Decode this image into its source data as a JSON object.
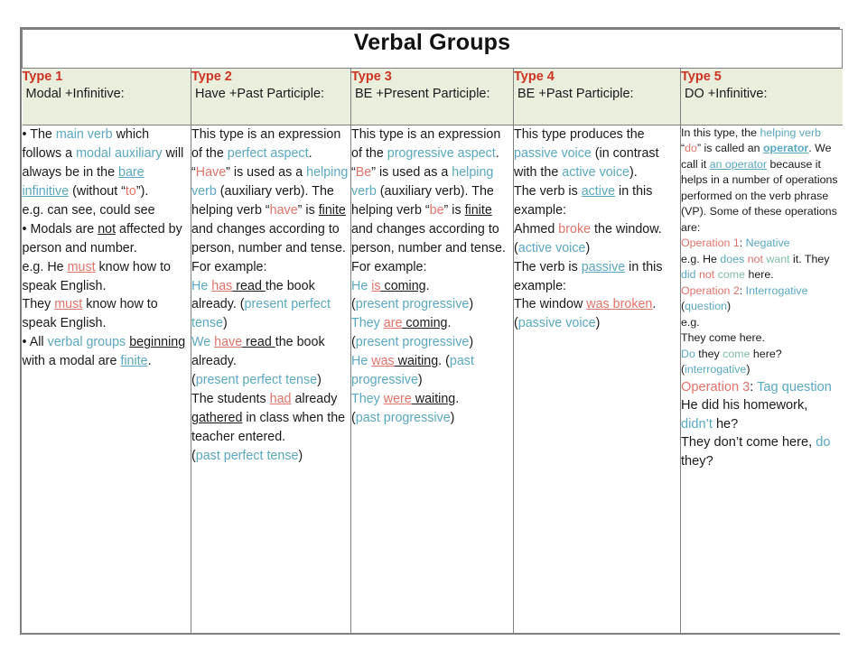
{
  "title": "Verbal Groups",
  "colors": {
    "header_bg": "#eaeedd",
    "type_heading": "#cc3322",
    "teal_term": "#5aa8c0",
    "red_emphasis": "#e0736a",
    "green_term": "#7fbfa8",
    "border": "#808080"
  },
  "columns": [
    {
      "type_label": "Type 1",
      "type_desc": "Modal +Infinitive:",
      "body": [
        {
          "runs": [
            {
              "t": "• The ",
              "s": "plain"
            },
            {
              "t": "main verb",
              "s": "teal"
            },
            {
              "t": " which follows a ",
              "s": "plain"
            },
            {
              "t": "modal auxiliary",
              "s": "teal"
            },
            {
              "t": " will always be in the ",
              "s": "plain"
            },
            {
              "t": "bare infinitive",
              "s": "teal-underline"
            },
            {
              "t": " (without “",
              "s": "plain"
            },
            {
              "t": "to",
              "s": "red"
            },
            {
              "t": "”).",
              "s": "plain"
            }
          ]
        },
        {
          "runs": [
            {
              "t": "e.g. can see, could see",
              "s": "plain"
            }
          ]
        },
        {
          "runs": [
            {
              "t": "• Modals are ",
              "s": "plain"
            },
            {
              "t": "not",
              "s": "underline"
            },
            {
              "t": " affected by person and number.",
              "s": "plain"
            }
          ]
        },
        {
          "runs": [
            {
              "t": "e.g. He ",
              "s": "plain"
            },
            {
              "t": "must",
              "s": "red-underline"
            },
            {
              "t": " know how to speak English.",
              "s": "plain"
            }
          ]
        },
        {
          "runs": [
            {
              "t": "They ",
              "s": "plain"
            },
            {
              "t": "must",
              "s": "red-underline"
            },
            {
              "t": " know how to speak English.",
              "s": "plain"
            }
          ]
        },
        {
          "runs": [
            {
              "t": "• All ",
              "s": "plain"
            },
            {
              "t": "verbal groups",
              "s": "teal"
            },
            {
              "t": " ",
              "s": "plain"
            },
            {
              "t": "beginning",
              "s": "underline"
            },
            {
              "t": " with a modal are ",
              "s": "plain"
            },
            {
              "t": "finite",
              "s": "teal-underline"
            },
            {
              "t": ".",
              "s": "plain"
            }
          ]
        }
      ]
    },
    {
      "type_label": "Type 2",
      "type_desc": " Have +Past Participle:",
      "body": [
        {
          "runs": [
            {
              "t": "This type is an expression of the ",
              "s": "plain"
            },
            {
              "t": "perfect aspect",
              "s": "teal"
            },
            {
              "t": ". “",
              "s": "plain"
            },
            {
              "t": "Have",
              "s": "red"
            },
            {
              "t": "” is used as a ",
              "s": "plain"
            },
            {
              "t": "helping verb",
              "s": "teal"
            },
            {
              "t": " (auxiliary verb). The helping verb “",
              "s": "plain"
            },
            {
              "t": "have",
              "s": "red"
            },
            {
              "t": "” is ",
              "s": "plain"
            },
            {
              "t": "finite",
              "s": "underline"
            },
            {
              "t": " and changes according to person, number and tense.",
              "s": "plain"
            }
          ]
        },
        {
          "runs": [
            {
              "t": "For example:",
              "s": "plain"
            }
          ]
        },
        {
          "runs": [
            {
              "t": "He ",
              "s": "teal"
            },
            {
              "t": "has",
              "s": "red-underline"
            },
            {
              "t": " read ",
              "s": "underline"
            },
            {
              "t": "the book already. (",
              "s": "plain"
            },
            {
              "t": "present perfect tense",
              "s": "teal"
            },
            {
              "t": ")",
              "s": "plain"
            }
          ]
        },
        {
          "runs": [
            {
              "t": "We ",
              "s": "teal"
            },
            {
              "t": "have",
              "s": "red-underline"
            },
            {
              "t": " read ",
              "s": "underline"
            },
            {
              "t": "the book already.",
              "s": "plain"
            }
          ]
        },
        {
          "runs": [
            {
              "t": "(",
              "s": "plain"
            },
            {
              "t": "present perfect tense",
              "s": "teal"
            },
            {
              "t": ")",
              "s": "plain"
            }
          ]
        },
        {
          "runs": [
            {
              "t": "The students ",
              "s": "plain"
            },
            {
              "t": "had",
              "s": "red-underline"
            },
            {
              "t": " already ",
              "s": "plain"
            },
            {
              "t": "gathered",
              "s": "underline"
            },
            {
              "t": " in class when the teacher entered.",
              "s": "plain"
            }
          ]
        },
        {
          "runs": [
            {
              "t": "(",
              "s": "plain"
            },
            {
              "t": "past perfect tense",
              "s": "teal"
            },
            {
              "t": ")",
              "s": "plain"
            }
          ]
        }
      ]
    },
    {
      "type_label": "Type 3",
      "type_desc": " BE +Present Participle:",
      "body": [
        {
          "runs": [
            {
              "t": "This type is an expression of the ",
              "s": "plain"
            },
            {
              "t": "progressive aspect",
              "s": "teal"
            },
            {
              "t": ". “",
              "s": "plain"
            },
            {
              "t": "Be",
              "s": "red"
            },
            {
              "t": "” is used as a ",
              "s": "plain"
            },
            {
              "t": "helping verb",
              "s": "teal"
            },
            {
              "t": " (auxiliary verb). The helping verb “",
              "s": "plain"
            },
            {
              "t": "be",
              "s": "red"
            },
            {
              "t": "” is ",
              "s": "plain"
            },
            {
              "t": "finite",
              "s": "underline"
            },
            {
              "t": " and changes according to person, number and tense.",
              "s": "plain"
            }
          ]
        },
        {
          "runs": [
            {
              "t": "For example:",
              "s": "plain"
            }
          ]
        },
        {
          "runs": [
            {
              "t": "He ",
              "s": "teal"
            },
            {
              "t": "is",
              "s": "red-underline"
            },
            {
              "t": " coming",
              "s": "underline"
            },
            {
              "t": ".",
              "s": "plain"
            }
          ]
        },
        {
          "runs": [
            {
              "t": "(",
              "s": "plain"
            },
            {
              "t": "present progressive",
              "s": "teal"
            },
            {
              "t": ")",
              "s": "plain"
            }
          ]
        },
        {
          "runs": [
            {
              "t": "They ",
              "s": "teal"
            },
            {
              "t": "are",
              "s": "red-underline"
            },
            {
              "t": " coming",
              "s": "underline"
            },
            {
              "t": ".",
              "s": "plain"
            }
          ]
        },
        {
          "runs": [
            {
              "t": "(",
              "s": "plain"
            },
            {
              "t": "present progressive",
              "s": "teal"
            },
            {
              "t": ")",
              "s": "plain"
            }
          ]
        },
        {
          "runs": [
            {
              "t": "He ",
              "s": "teal"
            },
            {
              "t": "was",
              "s": "red-underline"
            },
            {
              "t": " waiting",
              "s": "underline"
            },
            {
              "t": ". (",
              "s": "plain"
            },
            {
              "t": "past progressive",
              "s": "teal"
            },
            {
              "t": ")",
              "s": "plain"
            }
          ]
        },
        {
          "runs": [
            {
              "t": "They ",
              "s": "teal"
            },
            {
              "t": "were",
              "s": "red-underline"
            },
            {
              "t": " waiting",
              "s": "underline"
            },
            {
              "t": ".",
              "s": "plain"
            }
          ]
        },
        {
          "runs": [
            {
              "t": "(",
              "s": "plain"
            },
            {
              "t": "past progressive",
              "s": "teal"
            },
            {
              "t": ")",
              "s": "plain"
            }
          ]
        }
      ]
    },
    {
      "type_label": "Type 4",
      "type_desc": " BE +Past Participle:",
      "body": [
        {
          "runs": [
            {
              "t": "This type produces the ",
              "s": "plain"
            },
            {
              "t": "passive voice",
              "s": "teal"
            },
            {
              "t": " (in contrast with the ",
              "s": "plain"
            },
            {
              "t": "active voice",
              "s": "teal"
            },
            {
              "t": ").",
              "s": "plain"
            }
          ]
        },
        {
          "runs": [
            {
              "t": "The verb is ",
              "s": "plain"
            },
            {
              "t": "active",
              "s": "teal-underline"
            },
            {
              "t": " in this example:",
              "s": "plain"
            }
          ]
        },
        {
          "runs": [
            {
              "t": "Ahmed ",
              "s": "plain"
            },
            {
              "t": "broke",
              "s": "red"
            },
            {
              "t": " the window. (",
              "s": "plain"
            },
            {
              "t": "active voice",
              "s": "teal"
            },
            {
              "t": ")",
              "s": "plain"
            }
          ]
        },
        {
          "runs": [
            {
              "t": "The verb is ",
              "s": "plain"
            },
            {
              "t": "passive",
              "s": "teal-underline"
            },
            {
              "t": " in this example:",
              "s": "plain"
            }
          ]
        },
        {
          "runs": [
            {
              "t": "The window ",
              "s": "plain"
            },
            {
              "t": "was broken",
              "s": "red-underline"
            },
            {
              "t": ". (",
              "s": "plain"
            },
            {
              "t": "passive voice",
              "s": "teal"
            },
            {
              "t": ")",
              "s": "plain"
            }
          ]
        }
      ]
    },
    {
      "type_label": "Type 5",
      "type_desc": " DO +Infinitive:",
      "small": true,
      "body": [
        {
          "runs": [
            {
              "t": "In this type, the ",
              "s": "plain"
            },
            {
              "t": "helping verb",
              "s": "teal"
            },
            {
              "t": " “",
              "s": "plain"
            },
            {
              "t": "do",
              "s": "red"
            },
            {
              "t": "” is called an ",
              "s": "plain"
            },
            {
              "t": "operator",
              "s": "teal-bold-underline"
            },
            {
              "t": ". We call it ",
              "s": "plain"
            },
            {
              "t": "an operator",
              "s": "teal-underline"
            },
            {
              "t": " because it helps in a number of operations performed on the verb phrase (VP). Some of these operations are:",
              "s": "plain"
            }
          ]
        },
        {
          "runs": [
            {
              "t": "Operation 1",
              "s": "red"
            },
            {
              "t": ": ",
              "s": "plain"
            },
            {
              "t": "Negative",
              "s": "teal"
            }
          ]
        },
        {
          "runs": [
            {
              "t": "e.g.  He ",
              "s": "plain"
            },
            {
              "t": "does",
              "s": "teal"
            },
            {
              "t": " ",
              "s": "plain"
            },
            {
              "t": "not",
              "s": "red"
            },
            {
              "t": " ",
              "s": "plain"
            },
            {
              "t": "want",
              "s": "green"
            },
            {
              "t": " it. They ",
              "s": "plain"
            },
            {
              "t": "did",
              "s": "teal"
            },
            {
              "t": " ",
              "s": "plain"
            },
            {
              "t": "not",
              "s": "red"
            },
            {
              "t": " ",
              "s": "plain"
            },
            {
              "t": "come",
              "s": "green"
            },
            {
              "t": " here.",
              "s": "plain"
            }
          ]
        },
        {
          "runs": [
            {
              "t": "Operation 2",
              "s": "red"
            },
            {
              "t": ": ",
              "s": "plain"
            },
            {
              "t": "Interrogative",
              "s": "teal"
            },
            {
              "t": " (",
              "s": "plain"
            },
            {
              "t": "question",
              "s": "teal"
            },
            {
              "t": ")",
              "s": "plain"
            }
          ]
        },
        {
          "runs": [
            {
              "t": "e.g.",
              "s": "plain"
            }
          ]
        },
        {
          "runs": [
            {
              "t": "They come here.",
              "s": "plain"
            }
          ]
        },
        {
          "runs": [
            {
              "t": "Do",
              "s": "teal"
            },
            {
              "t": " they ",
              "s": "plain"
            },
            {
              "t": "come",
              "s": "green"
            },
            {
              "t": " here?",
              "s": "plain"
            }
          ]
        },
        {
          "runs": [
            {
              "t": "(",
              "s": "plain"
            },
            {
              "t": "interrogative",
              "s": "teal"
            },
            {
              "t": ")",
              "s": "plain"
            }
          ]
        },
        {
          "runs": [
            {
              "t": "Operation 3",
              "s": "red-big"
            },
            {
              "t": ": ",
              "s": "big"
            },
            {
              "t": "Tag question",
              "s": "teal-big"
            }
          ]
        },
        {
          "runs": [
            {
              "t": "He did his homework, ",
              "s": "big"
            },
            {
              "t": "didn’t",
              "s": "teal-big"
            },
            {
              "t": " he?",
              "s": "big"
            }
          ]
        },
        {
          "runs": [
            {
              "t": "They don’t come here, ",
              "s": "big"
            },
            {
              "t": "do",
              "s": "teal-big"
            },
            {
              "t": " they?",
              "s": "big"
            }
          ]
        }
      ]
    }
  ]
}
